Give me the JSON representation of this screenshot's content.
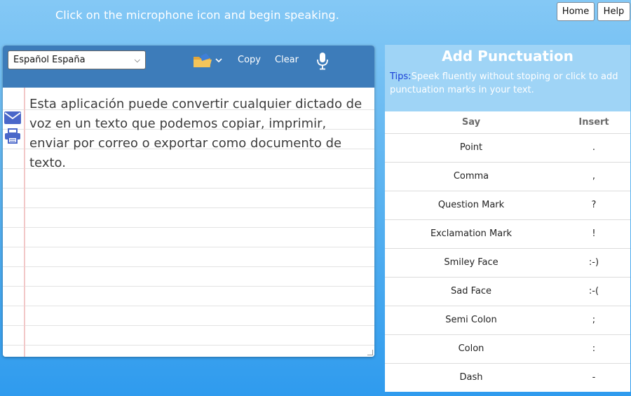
{
  "header": {
    "instruction": "Click on the microphone icon and begin speaking.",
    "home_label": "Home",
    "help_label": "Help"
  },
  "toolbar": {
    "language_selected": "Español España",
    "copy_label": "Copy",
    "clear_label": "Clear"
  },
  "editor": {
    "text": "Esta aplicación puede convertir cualquier dictado de voz en un texto que podemos copiar, imprimir, enviar por correo o exportar como documento de texto."
  },
  "panel": {
    "title": "Add Punctuation",
    "tips_label": "Tips:",
    "tips_text": "Speek fluently without stoping or click to add punctuation marks in your text.",
    "col_say": "Say",
    "col_insert": "Insert",
    "rows": [
      {
        "say": "Point",
        "insert": "."
      },
      {
        "say": "Comma",
        "insert": ","
      },
      {
        "say": "Question Mark",
        "insert": "?"
      },
      {
        "say": "Exclamation Mark",
        "insert": "!"
      },
      {
        "say": "Smiley Face",
        "insert": ":-)"
      },
      {
        "say": "Sad Face",
        "insert": ":-("
      },
      {
        "say": "Semi Colon",
        "insert": ";"
      },
      {
        "say": "Colon",
        "insert": ":"
      },
      {
        "say": "Dash",
        "insert": "-"
      }
    ]
  },
  "colors": {
    "toolbar": "#3d7cba",
    "panel_header": "#9fd4f6",
    "icon_blue": "#4a67c9",
    "tips_label": "#1a3fd6"
  }
}
